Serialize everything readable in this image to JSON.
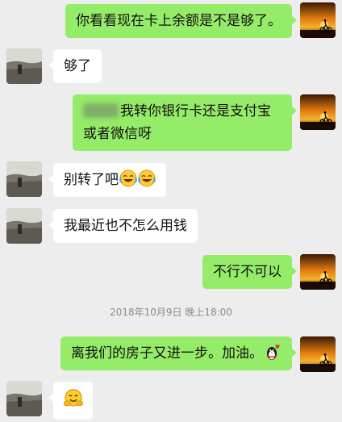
{
  "messages": [
    {
      "from": "me",
      "text": "你看看现在卡上余额是不是够了。"
    },
    {
      "from": "other",
      "text": "够了"
    },
    {
      "from": "me",
      "text": "我转你银行卡还是支付宝或者微信呀"
    },
    {
      "from": "other",
      "text": "别转了吧"
    },
    {
      "from": "other",
      "text": "我最近也不怎么用钱"
    },
    {
      "from": "me",
      "text": "不行不可以"
    },
    {
      "from": "me",
      "text": "离我们的房子又进一步。加油。"
    },
    {
      "from": "other",
      "text": ""
    }
  ],
  "timestamp": "2018年10月9日 晚上18:00",
  "colors": {
    "background": "#ededed",
    "my_bubble": "#95ec69",
    "their_bubble": "#ffffff"
  },
  "icons": {
    "my_avatar": "sunset-cyclist-avatar-icon",
    "their_avatar": "rocky-shore-avatar-icon",
    "laugh_emoji": "laughing-tears-emoji-icon",
    "qq_penguin": "penguin-heart-sticker-icon",
    "hug_emoji": "hugging-face-emoji-icon"
  }
}
